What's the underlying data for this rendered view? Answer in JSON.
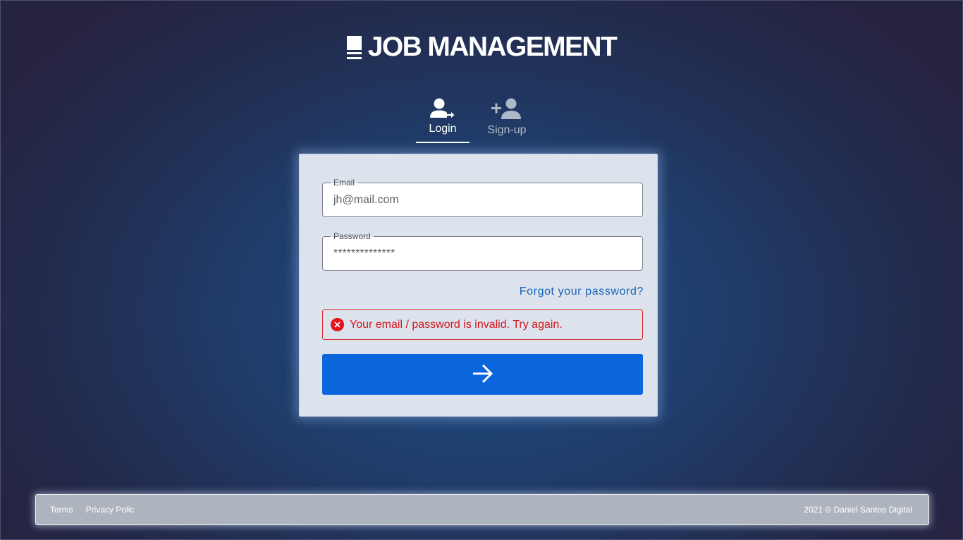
{
  "header": {
    "title": "JOB MANAGEMENT",
    "logo_icon": "stacked-book-icon"
  },
  "tabs": [
    {
      "label": "Login",
      "icon": "user-login-arrow-icon",
      "active": true
    },
    {
      "label": "Sign-up",
      "icon": "add-user-icon",
      "active": false
    }
  ],
  "form": {
    "email": {
      "label": "Email",
      "value": "jh@mail.com"
    },
    "password": {
      "label": "Password",
      "value": "**************"
    },
    "forgot_link": "Forgot your password?",
    "error": {
      "message": "Your email / password is invalid. Try again.",
      "icon": "error-circle-x-icon"
    },
    "submit_icon": "arrow-right-icon"
  },
  "footer": {
    "terms": "Terms",
    "privacy": "Privacy Polic",
    "copyright": "2021 © Daniel Santos Digital"
  },
  "colors": {
    "primary": "#0b66dd",
    "error": "#d9252b",
    "link": "#1565c0",
    "card_background": "#dde3ec",
    "page_background": "#1f3d6c"
  }
}
